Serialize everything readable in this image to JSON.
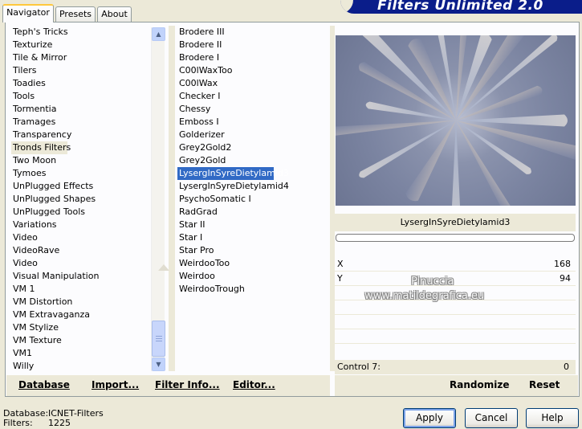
{
  "app": {
    "title": "Filters Unlimited 2.0"
  },
  "tabs": [
    {
      "label": "Navigator"
    },
    {
      "label": "Presets"
    },
    {
      "label": "About"
    }
  ],
  "categories": [
    "Teph's Tricks",
    "Texturize",
    "Tile & Mirror",
    "Tilers",
    "Toadies",
    "Tools",
    "Tormentia",
    "Tramages",
    "Transparency",
    "Tronds Filters",
    "Two Moon",
    "Tymoes",
    "UnPlugged Effects",
    "UnPlugged Shapes",
    "UnPlugged Tools",
    "Variations",
    "Video",
    "VideoRave",
    "Video",
    "Visual Manipulation",
    "VM 1",
    "VM Distortion",
    "VM Extravaganza",
    "VM Stylize",
    "VM Texture",
    "VM1",
    "Willy"
  ],
  "selected_category": "Tronds Filters",
  "filters": [
    "Brodere III",
    "Brodere II",
    "Brodere I",
    "C00lWaxToo",
    "C00lWax",
    "Checker I",
    "Chessy",
    "Emboss I",
    "Golderizer",
    "Grey2Gold2",
    "Grey2Gold",
    "LysergInSyreDietylamid3",
    "LysergInSyreDietylamid4",
    "PsychoSomatic I",
    "RadGrad",
    "Star II",
    "Star I",
    "Star Pro",
    "WeirdooToo",
    "Weirdoo",
    "WeirdooTrough"
  ],
  "selected_filter": "LysergInSyreDietylamid3",
  "preview": {
    "filter_name": "LysergInSyreDietylamid3"
  },
  "params": [
    {
      "label": "X",
      "value": "168"
    },
    {
      "label": "Y",
      "value": "94"
    }
  ],
  "control7": {
    "label": "Control 7:",
    "value": "0"
  },
  "watermark": {
    "line1": "Pinuccia",
    "line2": "www.matildegrafica.eu"
  },
  "bottom_left": {
    "database": "Database",
    "import": "Import...",
    "filter_info": "Filter Info...",
    "editor": "Editor..."
  },
  "bottom_right": {
    "randomize": "Randomize",
    "reset": "Reset"
  },
  "footer": {
    "database_label": "Database:",
    "database_value": "ICNET-Filters",
    "filters_label": "Filters:",
    "filters_value": "1225"
  },
  "buttons": {
    "apply": "Apply",
    "cancel": "Cancel",
    "help": "Help"
  },
  "colors": {
    "selection": "#316ac5",
    "banner": "#0a1d8a",
    "window_bg": "#ece9d8"
  }
}
